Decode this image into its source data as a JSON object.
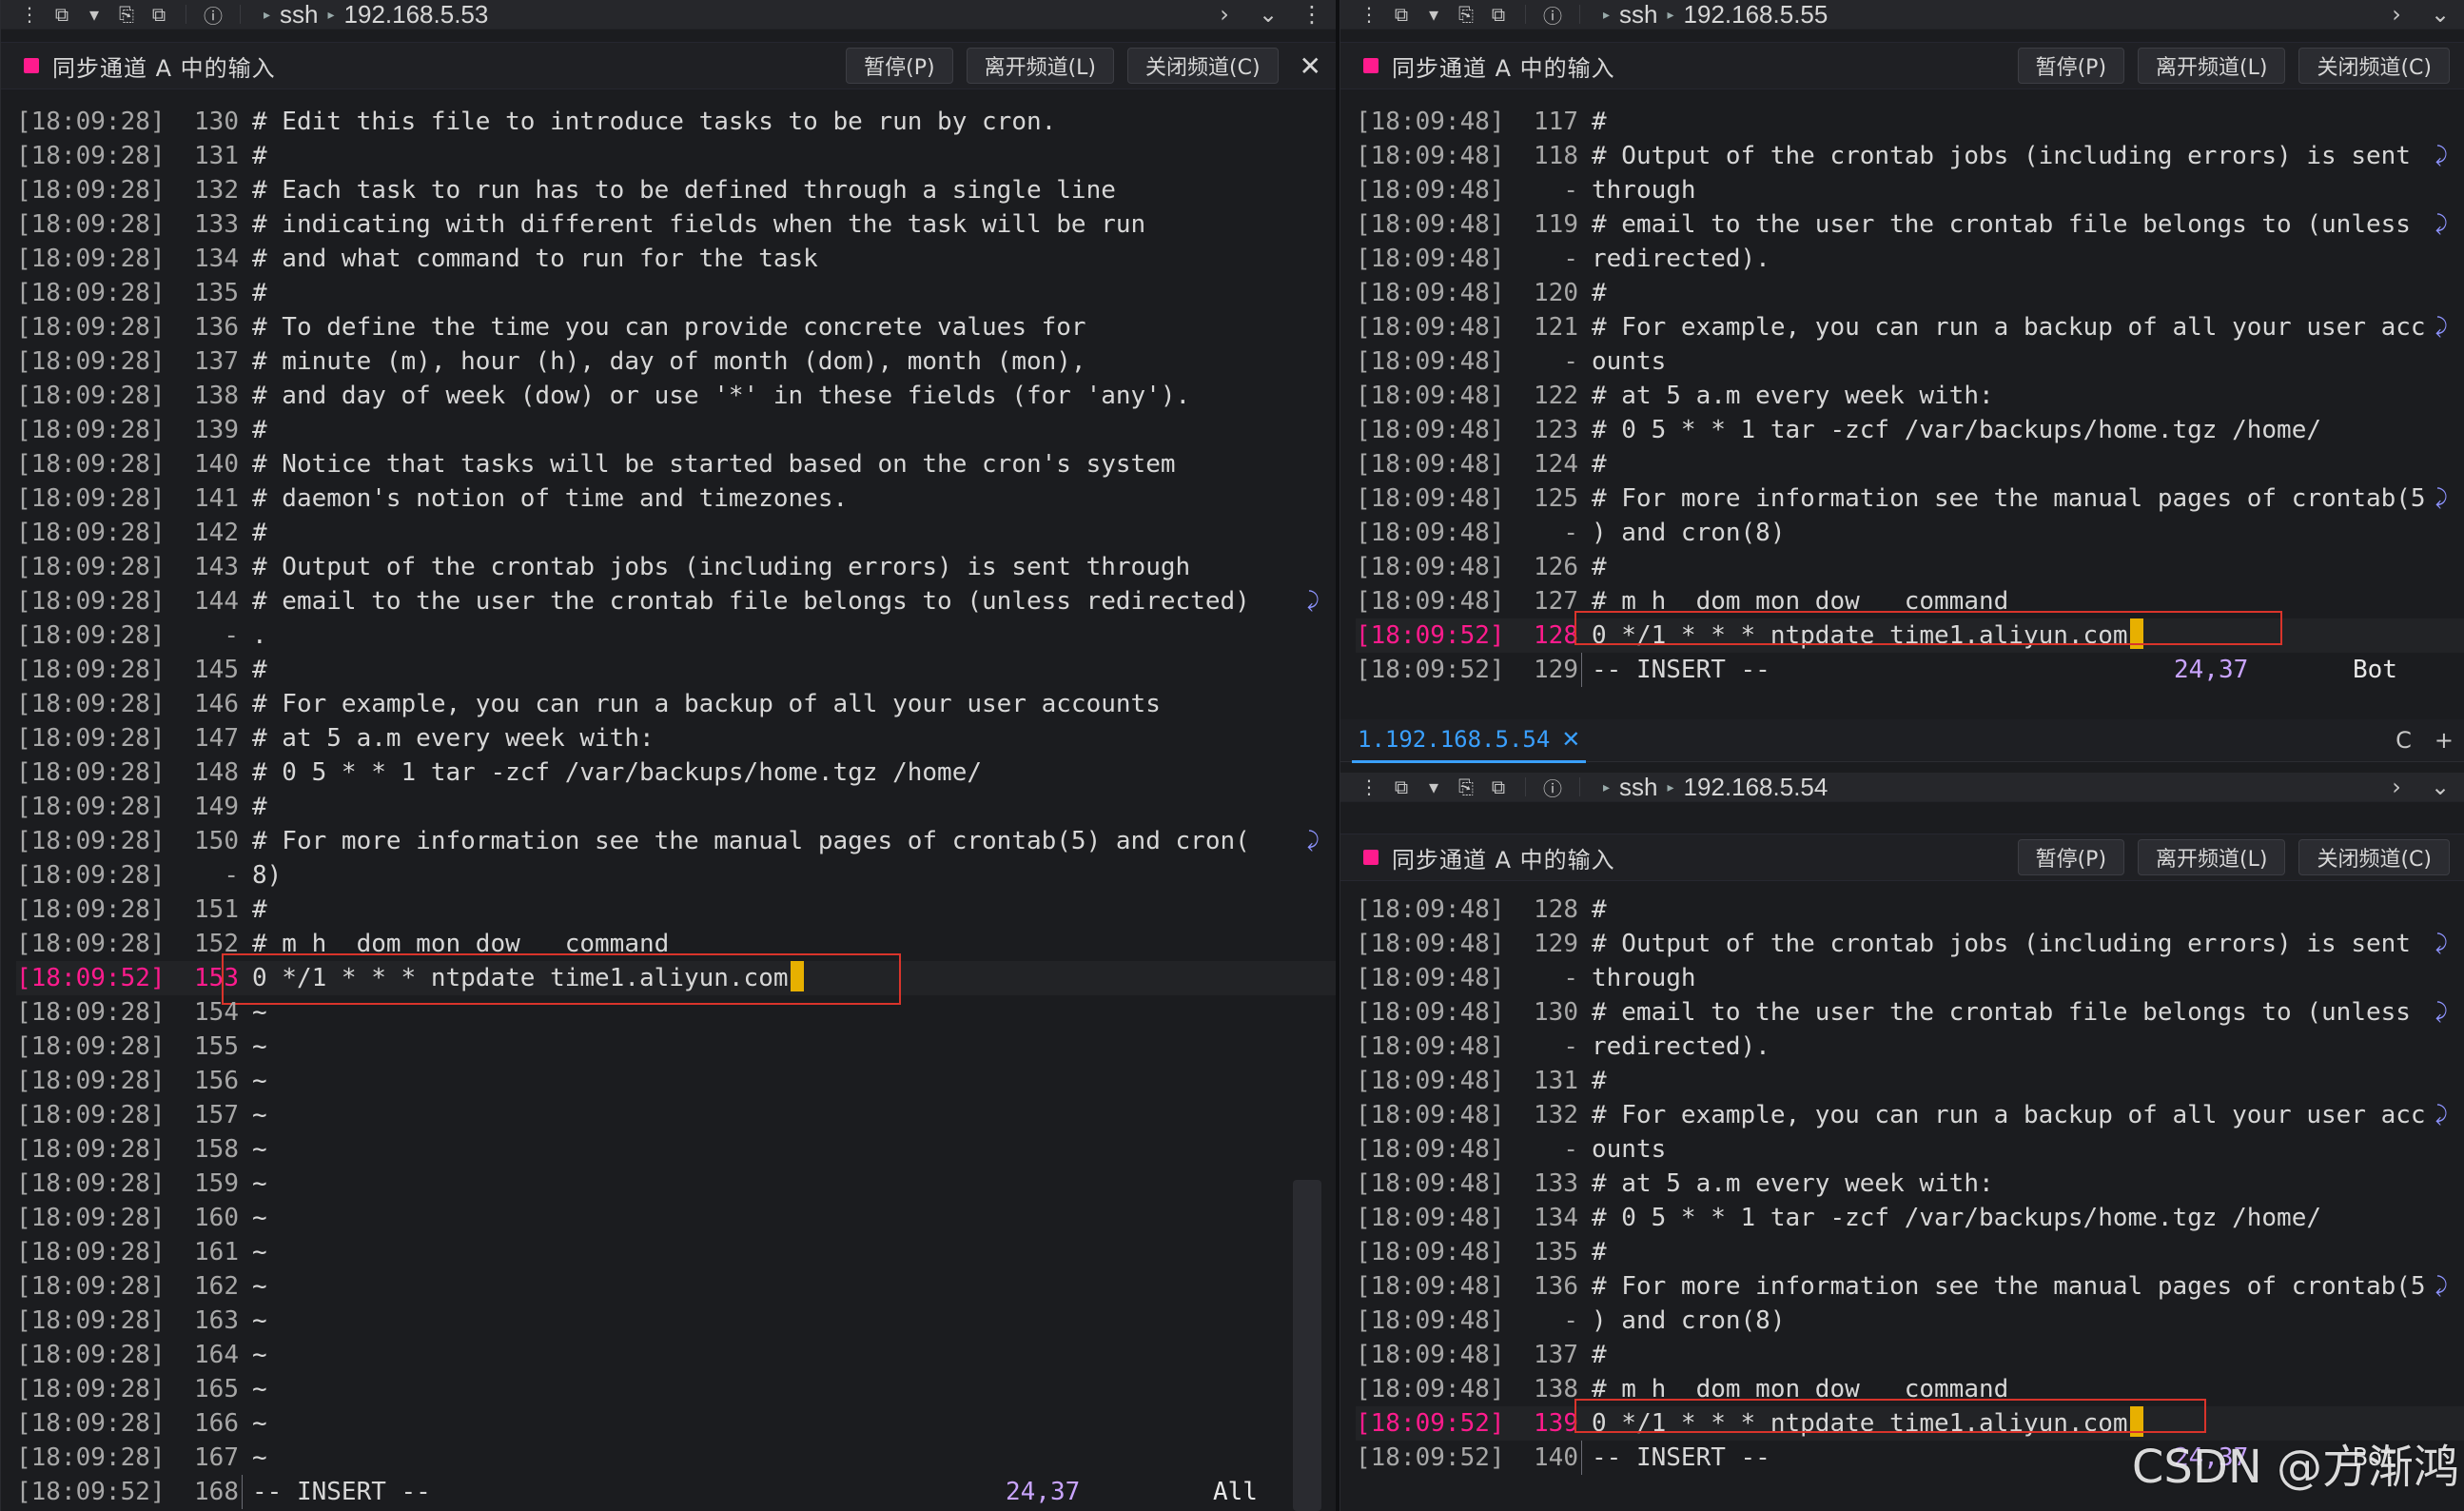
{
  "left": {
    "toolbar": {
      "ssh_label": "ssh",
      "host": "192.168.5.53"
    },
    "sync": {
      "label": "同步通道 A 中的输入",
      "pause": "暂停(P)",
      "leave": "离开频道(L)",
      "close_channel": "关闭频道(C)",
      "close_symbol": "✕"
    },
    "lines": [
      {
        "ts": "[18:09:28]",
        "ln": "130",
        "text": "# Edit this file to introduce tasks to be run by cron."
      },
      {
        "ts": "[18:09:28]",
        "ln": "131",
        "text": "#"
      },
      {
        "ts": "[18:09:28]",
        "ln": "132",
        "text": "# Each task to run has to be defined through a single line"
      },
      {
        "ts": "[18:09:28]",
        "ln": "133",
        "text": "# indicating with different fields when the task will be run"
      },
      {
        "ts": "[18:09:28]",
        "ln": "134",
        "text": "# and what command to run for the task"
      },
      {
        "ts": "[18:09:28]",
        "ln": "135",
        "text": "#"
      },
      {
        "ts": "[18:09:28]",
        "ln": "136",
        "text": "# To define the time you can provide concrete values for"
      },
      {
        "ts": "[18:09:28]",
        "ln": "137",
        "text": "# minute (m), hour (h), day of month (dom), month (mon),"
      },
      {
        "ts": "[18:09:28]",
        "ln": "138",
        "text": "# and day of week (dow) or use '*' in these fields (for 'any')."
      },
      {
        "ts": "[18:09:28]",
        "ln": "139",
        "text": "#"
      },
      {
        "ts": "[18:09:28]",
        "ln": "140",
        "text": "# Notice that tasks will be started based on the cron's system"
      },
      {
        "ts": "[18:09:28]",
        "ln": "141",
        "text": "# daemon's notion of time and timezones."
      },
      {
        "ts": "[18:09:28]",
        "ln": "142",
        "text": "#"
      },
      {
        "ts": "[18:09:28]",
        "ln": "143",
        "text": "# Output of the crontab jobs (including errors) is sent through"
      },
      {
        "ts": "[18:09:28]",
        "ln": "144",
        "text": "# email to the user the crontab file belongs to (unless redirected)",
        "wrap": "⤸"
      },
      {
        "ts": "[18:09:28]",
        "ln": "-",
        "text": "."
      },
      {
        "ts": "[18:09:28]",
        "ln": "145",
        "text": "#"
      },
      {
        "ts": "[18:09:28]",
        "ln": "146",
        "text": "# For example, you can run a backup of all your user accounts"
      },
      {
        "ts": "[18:09:28]",
        "ln": "147",
        "text": "# at 5 a.m every week with:"
      },
      {
        "ts": "[18:09:28]",
        "ln": "148",
        "text": "# 0 5 * * 1 tar -zcf /var/backups/home.tgz /home/"
      },
      {
        "ts": "[18:09:28]",
        "ln": "149",
        "text": "#"
      },
      {
        "ts": "[18:09:28]",
        "ln": "150",
        "text": "# For more information see the manual pages of crontab(5) and cron(",
        "wrap": "⤸"
      },
      {
        "ts": "[18:09:28]",
        "ln": "-",
        "text": "8)"
      },
      {
        "ts": "[18:09:28]",
        "ln": "151",
        "text": "#"
      },
      {
        "ts": "[18:09:28]",
        "ln": "152",
        "text": "# m h  dom mon dow   command"
      },
      {
        "ts": "[18:09:52]",
        "ln": "153",
        "text": "0 */1 * * * ntpdate time1.aliyun.com",
        "active": true,
        "cursor": true
      },
      {
        "ts": "[18:09:28]",
        "ln": "154",
        "text": "~"
      },
      {
        "ts": "[18:09:28]",
        "ln": "155",
        "text": "~"
      },
      {
        "ts": "[18:09:28]",
        "ln": "156",
        "text": "~"
      },
      {
        "ts": "[18:09:28]",
        "ln": "157",
        "text": "~"
      },
      {
        "ts": "[18:09:28]",
        "ln": "158",
        "text": "~"
      },
      {
        "ts": "[18:09:28]",
        "ln": "159",
        "text": "~"
      },
      {
        "ts": "[18:09:28]",
        "ln": "160",
        "text": "~"
      },
      {
        "ts": "[18:09:28]",
        "ln": "161",
        "text": "~"
      },
      {
        "ts": "[18:09:28]",
        "ln": "162",
        "text": "~"
      },
      {
        "ts": "[18:09:28]",
        "ln": "163",
        "text": "~"
      },
      {
        "ts": "[18:09:28]",
        "ln": "164",
        "text": "~"
      },
      {
        "ts": "[18:09:28]",
        "ln": "165",
        "text": "~"
      },
      {
        "ts": "[18:09:28]",
        "ln": "166",
        "text": "~"
      },
      {
        "ts": "[18:09:28]",
        "ln": "167",
        "text": "~"
      }
    ],
    "status": {
      "ts": "[18:09:52]",
      "ln": "168",
      "mode": "-- INSERT --",
      "pos": "24,37",
      "scroll": "All"
    }
  },
  "right_top": {
    "toolbar": {
      "ssh_label": "ssh",
      "host": "192.168.5.55"
    },
    "sync": {
      "label": "同步通道 A 中的输入",
      "pause": "暂停(P)",
      "leave": "离开频道(L)",
      "close_channel": "关闭频道(C)"
    },
    "lines": [
      {
        "ts": "[18:09:48]",
        "ln": "117",
        "text": "#"
      },
      {
        "ts": "[18:09:48]",
        "ln": "118",
        "text": "# Output of the crontab jobs (including errors) is sent",
        "wrap": "⤸"
      },
      {
        "ts": "[18:09:48]",
        "ln": "-",
        "text": "through"
      },
      {
        "ts": "[18:09:48]",
        "ln": "119",
        "text": "# email to the user the crontab file belongs to (unless",
        "wrap": "⤸"
      },
      {
        "ts": "[18:09:48]",
        "ln": "-",
        "text": "redirected)."
      },
      {
        "ts": "[18:09:48]",
        "ln": "120",
        "text": "#"
      },
      {
        "ts": "[18:09:48]",
        "ln": "121",
        "text": "# For example, you can run a backup of all your user acc",
        "wrap": "⤸"
      },
      {
        "ts": "[18:09:48]",
        "ln": "-",
        "text": "ounts"
      },
      {
        "ts": "[18:09:48]",
        "ln": "122",
        "text": "# at 5 a.m every week with:"
      },
      {
        "ts": "[18:09:48]",
        "ln": "123",
        "text": "# 0 5 * * 1 tar -zcf /var/backups/home.tgz /home/"
      },
      {
        "ts": "[18:09:48]",
        "ln": "124",
        "text": "#"
      },
      {
        "ts": "[18:09:48]",
        "ln": "125",
        "text": "# For more information see the manual pages of crontab(5",
        "wrap": "⤸"
      },
      {
        "ts": "[18:09:48]",
        "ln": "-",
        "text": ") and cron(8)"
      },
      {
        "ts": "[18:09:48]",
        "ln": "126",
        "text": "#"
      },
      {
        "ts": "[18:09:48]",
        "ln": "127",
        "text": "# m h  dom mon dow   command"
      },
      {
        "ts": "[18:09:52]",
        "ln": "128",
        "text": "0 */1 * * * ntpdate time1.aliyun.com",
        "active": true,
        "cursor": true
      }
    ],
    "status": {
      "ts": "[18:09:52]",
      "ln": "129",
      "mode": "-- INSERT --",
      "pos": "24,37",
      "scroll": "Bot"
    }
  },
  "right_bottom": {
    "tab": {
      "label": "1.192.168.5.54",
      "close": "✕",
      "right_icon_c": "C",
      "right_icon_plus": "+"
    },
    "toolbar": {
      "ssh_label": "ssh",
      "host": "192.168.5.54"
    },
    "sync": {
      "label": "同步通道 A 中的输入",
      "pause": "暂停(P)",
      "leave": "离开频道(L)",
      "close_channel": "关闭频道(C)"
    },
    "lines": [
      {
        "ts": "[18:09:48]",
        "ln": "128",
        "text": "#"
      },
      {
        "ts": "[18:09:48]",
        "ln": "129",
        "text": "# Output of the crontab jobs (including errors) is sent",
        "wrap": "⤸"
      },
      {
        "ts": "[18:09:48]",
        "ln": "-",
        "text": "through"
      },
      {
        "ts": "[18:09:48]",
        "ln": "130",
        "text": "# email to the user the crontab file belongs to (unless",
        "wrap": "⤸"
      },
      {
        "ts": "[18:09:48]",
        "ln": "-",
        "text": "redirected)."
      },
      {
        "ts": "[18:09:48]",
        "ln": "131",
        "text": "#"
      },
      {
        "ts": "[18:09:48]",
        "ln": "132",
        "text": "# For example, you can run a backup of all your user acc",
        "wrap": "⤸"
      },
      {
        "ts": "[18:09:48]",
        "ln": "-",
        "text": "ounts"
      },
      {
        "ts": "[18:09:48]",
        "ln": "133",
        "text": "# at 5 a.m every week with:"
      },
      {
        "ts": "[18:09:48]",
        "ln": "134",
        "text": "# 0 5 * * 1 tar -zcf /var/backups/home.tgz /home/"
      },
      {
        "ts": "[18:09:48]",
        "ln": "135",
        "text": "#"
      },
      {
        "ts": "[18:09:48]",
        "ln": "136",
        "text": "# For more information see the manual pages of crontab(5",
        "wrap": "⤸"
      },
      {
        "ts": "[18:09:48]",
        "ln": "-",
        "text": ") and cron(8)"
      },
      {
        "ts": "[18:09:48]",
        "ln": "137",
        "text": "#"
      },
      {
        "ts": "[18:09:48]",
        "ln": "138",
        "text": "# m h  dom mon dow   command"
      },
      {
        "ts": "[18:09:52]",
        "ln": "139",
        "text": "0 */1 * * * ntpdate time1.aliyun.com",
        "active": true,
        "cursor": true
      }
    ],
    "status": {
      "ts": "[18:09:52]",
      "ln": "140",
      "mode": "-- INSERT --",
      "pos": "24,37",
      "scroll": "Bot"
    }
  },
  "watermark": "CSDN @方渐鸿",
  "colors": {
    "accent": "#3aa0ff",
    "magenta": "#ff1b8d",
    "cursor": "#e7b000",
    "highlight_box": "#d9342b"
  }
}
